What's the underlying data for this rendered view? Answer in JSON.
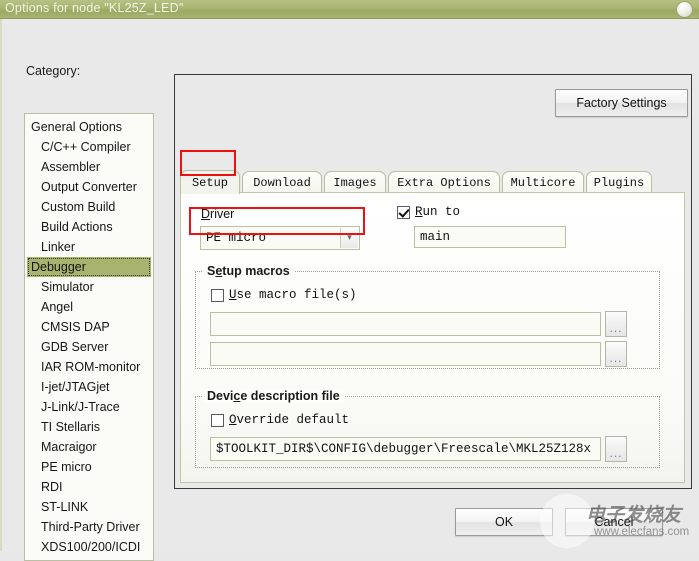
{
  "window": {
    "title": "Options for node \"KL25Z_LED\"",
    "close_icon": "close-circle-icon"
  },
  "sidebar": {
    "label": "Category:",
    "items": [
      {
        "label": "General Options",
        "indent": false,
        "selected": false
      },
      {
        "label": "C/C++ Compiler",
        "indent": true,
        "selected": false
      },
      {
        "label": "Assembler",
        "indent": true,
        "selected": false
      },
      {
        "label": "Output Converter",
        "indent": true,
        "selected": false
      },
      {
        "label": "Custom Build",
        "indent": true,
        "selected": false
      },
      {
        "label": "Build Actions",
        "indent": true,
        "selected": false
      },
      {
        "label": "Linker",
        "indent": true,
        "selected": false
      },
      {
        "label": "Debugger",
        "indent": true,
        "selected": true
      },
      {
        "label": "Simulator",
        "indent": true,
        "selected": false
      },
      {
        "label": "Angel",
        "indent": true,
        "selected": false
      },
      {
        "label": "CMSIS DAP",
        "indent": true,
        "selected": false
      },
      {
        "label": "GDB Server",
        "indent": true,
        "selected": false
      },
      {
        "label": "IAR ROM-monitor",
        "indent": true,
        "selected": false
      },
      {
        "label": "I-jet/JTAGjet",
        "indent": true,
        "selected": false
      },
      {
        "label": "J-Link/J-Trace",
        "indent": true,
        "selected": false
      },
      {
        "label": "TI Stellaris",
        "indent": true,
        "selected": false
      },
      {
        "label": "Macraigor",
        "indent": true,
        "selected": false
      },
      {
        "label": "PE micro",
        "indent": true,
        "selected": false
      },
      {
        "label": "RDI",
        "indent": true,
        "selected": false
      },
      {
        "label": "ST-LINK",
        "indent": true,
        "selected": false
      },
      {
        "label": "Third-Party Driver",
        "indent": true,
        "selected": false
      },
      {
        "label": "XDS100/200/ICDI",
        "indent": true,
        "selected": false
      }
    ]
  },
  "panel": {
    "factory_settings_label": "Factory Settings",
    "tabs": [
      {
        "label": "Setup",
        "active": true
      },
      {
        "label": "Download",
        "active": false
      },
      {
        "label": "Images",
        "active": false
      },
      {
        "label": "Extra Options",
        "active": false
      },
      {
        "label": "Multicore",
        "active": false
      },
      {
        "label": "Plugins",
        "active": false
      }
    ]
  },
  "setup": {
    "driver_label": "Driver",
    "driver_value": "PE micro",
    "driver_arrow": "▾",
    "runto_label": "Run to",
    "runto_checked": true,
    "runto_value": "main",
    "macros": {
      "title": "Setup macros",
      "use_macro_label": "Use macro file(s)",
      "use_macro_checked": false,
      "file1_value": "",
      "file2_value": "",
      "browse_label": "..."
    },
    "device_desc": {
      "title": "Device description file",
      "override_label": "Override default",
      "override_checked": false,
      "path_value": "$TOOLKIT_DIR$\\CONFIG\\debugger\\Freescale\\MKL25Z128x",
      "browse_label": "..."
    }
  },
  "footer": {
    "ok_label": "OK",
    "cancel_label": "Cancel"
  },
  "watermark": {
    "brand_cn": "电子发烧友",
    "url": "www.elecfans.com"
  },
  "colors": {
    "titlebar": "#a9b571",
    "selection": "#a8b46e",
    "annotation": "#ee1111",
    "field_border": "#b9bfa0"
  }
}
